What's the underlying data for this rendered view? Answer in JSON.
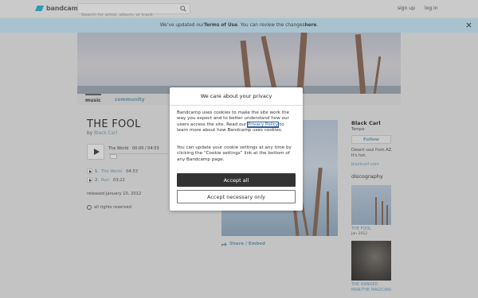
{
  "header": {
    "logo_text": "bandcamp",
    "search_placeholder": "Search for artist, album, or track",
    "signup": "sign up",
    "login": "log in"
  },
  "banner": {
    "text_before": "We’ve updated our ",
    "terms_link": "Terms of Use",
    "text_middle": ". You can review the changes ",
    "here_link": "here",
    "text_after": "."
  },
  "tabs": [
    {
      "label": "music",
      "active": true
    },
    {
      "label": "community",
      "active": false
    }
  ],
  "album": {
    "title": "THE FOOL",
    "by_prefix": "by ",
    "artist": "Black Carl",
    "player": {
      "track": "The World",
      "time": "00:00 / 04:53"
    },
    "tracks": [
      {
        "num": "1.",
        "name": "The World",
        "duration": "04:53"
      },
      {
        "num": "2.",
        "name": "Run",
        "duration": "03:22"
      }
    ],
    "released": "released January 10, 2012",
    "rights": "all rights reserved",
    "share": "Share / Embed"
  },
  "artist_panel": {
    "name": "Black Carl",
    "location": "Tempe",
    "follow": "Follow",
    "bio": "Desert soul from AZ. It's hot.",
    "url": "blackcarl.com",
    "discography_title": "discography",
    "discography": [
      {
        "title": "THE FOOL",
        "date": "Jan 2012"
      },
      {
        "title": "THE HANGED MAN/THE MAGICIAN",
        "date": ""
      }
    ]
  },
  "cookie_modal": {
    "heading": "We care about your privacy",
    "p1_before": "Bandcamp uses cookies to make the site work the way you expect and to better understand how our users access the site. Read our ",
    "p1_link": "Privacy Policy",
    "p1_after": " to learn more about how Bandcamp uses cookies.",
    "p2": "You can update your cookie settings at any time by clicking the “Cookie settings” link at the bottom of any Bandcamp page.",
    "accept_all": "Accept all",
    "accept_necessary": "Accept necessary only"
  },
  "colors": {
    "accent_link": "#5a8aa5",
    "banner_bg": "#b3d4e2",
    "logo_blue": "#1da0c3",
    "primary_button": "#333333"
  }
}
